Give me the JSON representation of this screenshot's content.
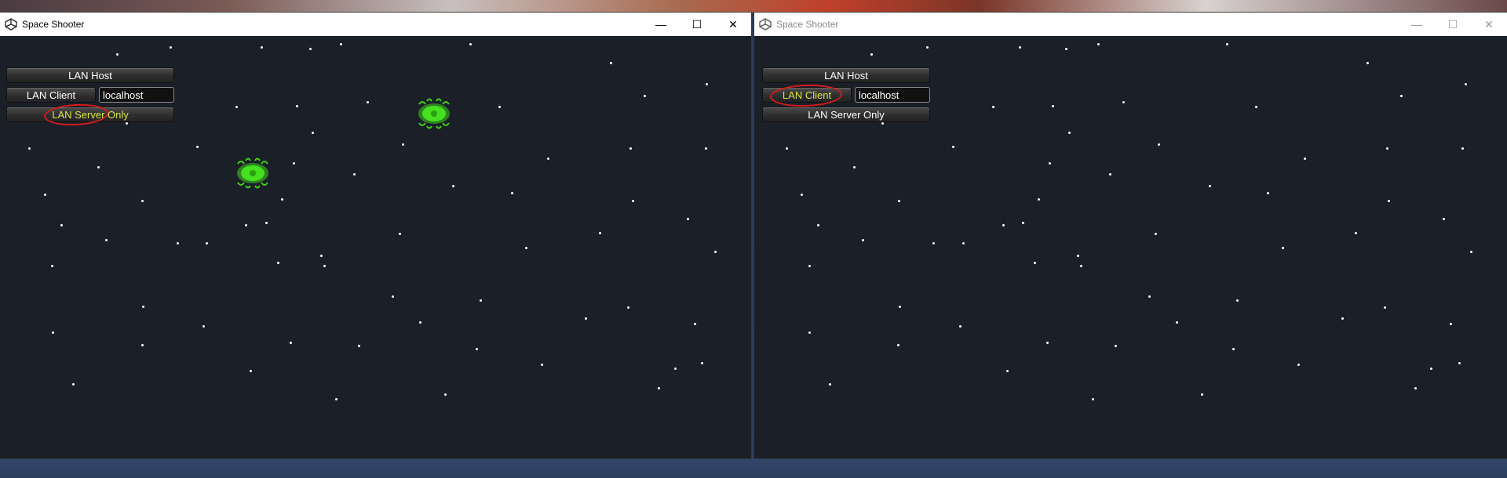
{
  "windows": [
    {
      "title": "Space Shooter",
      "menu": {
        "host_label": "LAN Host",
        "client_label": "LAN Client",
        "address_value": "localhost",
        "server_label": "LAN Server Only"
      },
      "highlighted": "server",
      "aliens": 2
    },
    {
      "title": "Space Shooter",
      "menu": {
        "host_label": "LAN Host",
        "client_label": "LAN Client",
        "address_value": "localhost",
        "server_label": "LAN Server Only"
      },
      "highlighted": "client",
      "aliens": 0
    }
  ],
  "window_controls": {
    "minimize": "—",
    "maximize": "☐",
    "close": "✕"
  },
  "colors": {
    "highlight_text": "#d8e83a",
    "annotation_ring": "#d81b1b",
    "alien": "#3fd11a",
    "space": "#1b1f28"
  },
  "icons": [
    "unity-icon",
    "alien-ship-icon"
  ]
}
